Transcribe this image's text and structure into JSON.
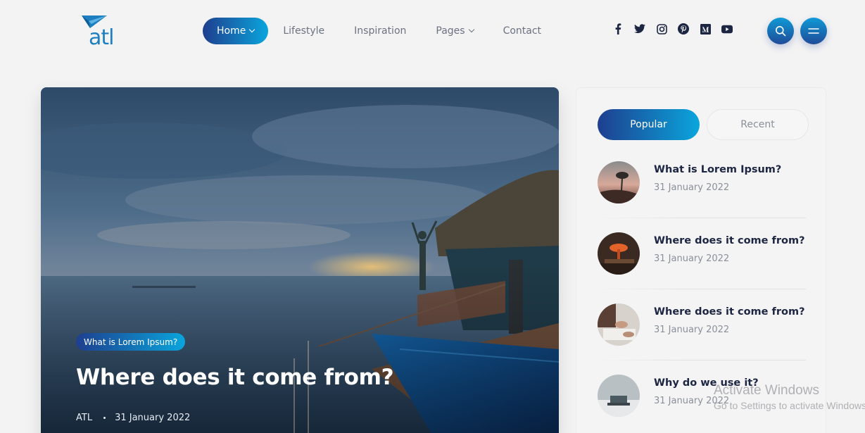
{
  "logo": {
    "text": "atl"
  },
  "nav": {
    "items": [
      {
        "label": "Home"
      },
      {
        "label": "Lifestyle"
      },
      {
        "label": "Inspiration"
      },
      {
        "label": "Pages"
      },
      {
        "label": "Contact"
      }
    ]
  },
  "socials": [
    "facebook-icon",
    "twitter-icon",
    "instagram-icon",
    "pinterest-icon",
    "medium-icon",
    "youtube-icon"
  ],
  "hero": {
    "category": "What is Lorem Ipsum?",
    "title": "Where does it come from?",
    "author": "ATL",
    "date": "31 January 2022"
  },
  "sidebar": {
    "tabs": [
      {
        "label": "Popular"
      },
      {
        "label": "Recent"
      }
    ],
    "posts": [
      {
        "title": "What is Lorem Ipsum?",
        "date": "31 January 2022"
      },
      {
        "title": "Where does it come from?",
        "date": "31 January 2022"
      },
      {
        "title": "Where does it come from?",
        "date": "31 January 2022"
      },
      {
        "title": "Why do we use it?",
        "date": "31 January 2022"
      }
    ]
  },
  "watermark": {
    "line1": "Activate Windows",
    "line2": "Go to Settings to activate Windows."
  },
  "colors": {
    "accent_start": "#1e3f8f",
    "accent_end": "#0aa5dc",
    "heading": "#1c2541"
  }
}
